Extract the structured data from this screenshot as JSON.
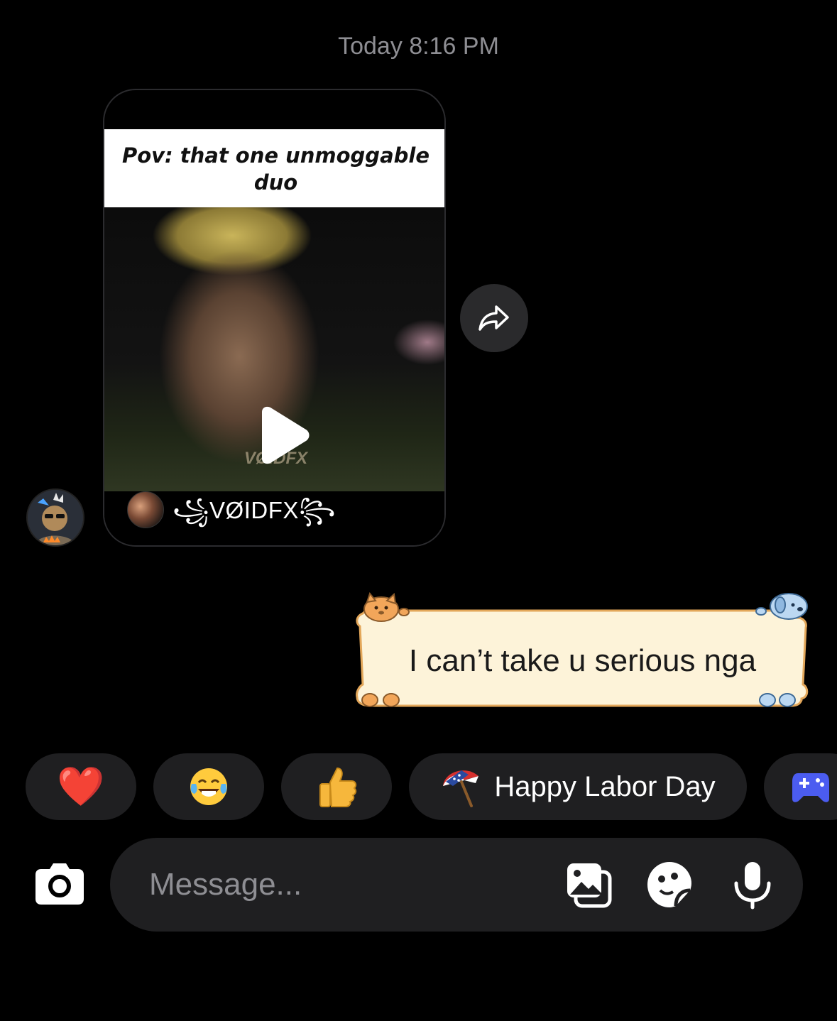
{
  "thread": {
    "timestamp": "Today 8:16 PM",
    "reel": {
      "caption": "Pov: that one unmoggable duo",
      "watermark": "VØIDFX",
      "author": "⸎ VØIDFX ⸎",
      "author_display": "꧁VØIDFX꧂"
    },
    "sent_message": "I can’t take u serious nga"
  },
  "quick_replies": [
    {
      "emoji": "❤️",
      "icon": "heart-emoji"
    },
    {
      "emoji": "😂",
      "icon": "tears-of-joy-emoji"
    },
    {
      "emoji": "👍",
      "icon": "thumbs-up-emoji"
    },
    {
      "emoji": "☂",
      "icon": "american-flag-umbrella-sticker",
      "label": "Happy Labor Day"
    },
    {
      "emoji": "🎮",
      "icon": "game-controller-icon"
    }
  ],
  "composer": {
    "placeholder": "Message..."
  },
  "colors": {
    "background": "#000000",
    "chip": "#1f1f21",
    "bubble_fill": "#fdf3d9",
    "bubble_border": "#e3a75a",
    "muted_text": "#8e8e93"
  }
}
